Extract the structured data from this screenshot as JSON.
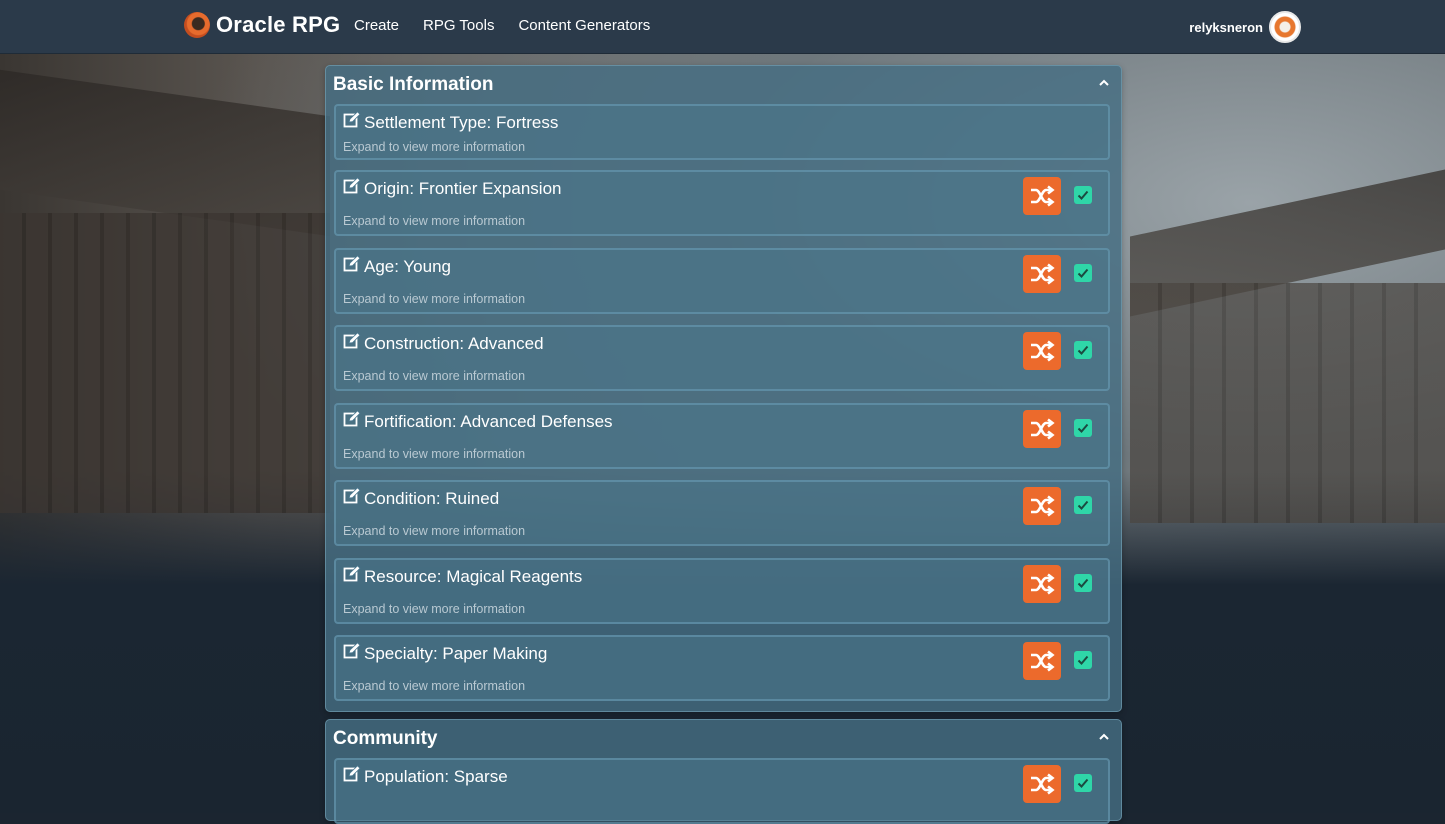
{
  "nav": {
    "brand": "Oracle RPG",
    "links": [
      "Create",
      "RPG Tools",
      "Content Generators"
    ],
    "username": "relyksneron"
  },
  "colors": {
    "accent": "#ec6a2c",
    "check": "#2fd6a8",
    "navbar": "#2b3a4a"
  },
  "basic": {
    "title": "Basic Information",
    "items": [
      {
        "label": "Settlement Type: Fortress",
        "hint": "Expand to view more information",
        "checked": false
      },
      {
        "label": "Origin: Frontier Expansion",
        "hint": "Expand to view more information",
        "checked": true
      },
      {
        "label": "Age: Young",
        "hint": "Expand to view more information",
        "checked": true
      },
      {
        "label": "Construction: Advanced",
        "hint": "Expand to view more information",
        "checked": true
      },
      {
        "label": "Fortification: Advanced Defenses",
        "hint": "Expand to view more information",
        "checked": true
      },
      {
        "label": "Condition: Ruined",
        "hint": "Expand to view more information",
        "checked": true
      },
      {
        "label": "Resource: Magical Reagents",
        "hint": "Expand to view more information",
        "checked": true
      },
      {
        "label": "Specialty: Paper Making",
        "hint": "Expand to view more information",
        "checked": true
      }
    ]
  },
  "community": {
    "title": "Community",
    "items": [
      {
        "label": "Population: Sparse",
        "checked": true
      }
    ]
  },
  "icons": {
    "edit": "edit-icon",
    "shuffle": "shuffle-icon",
    "check": "checkbox-checked-icon",
    "collapse": "chevron-up-icon"
  }
}
